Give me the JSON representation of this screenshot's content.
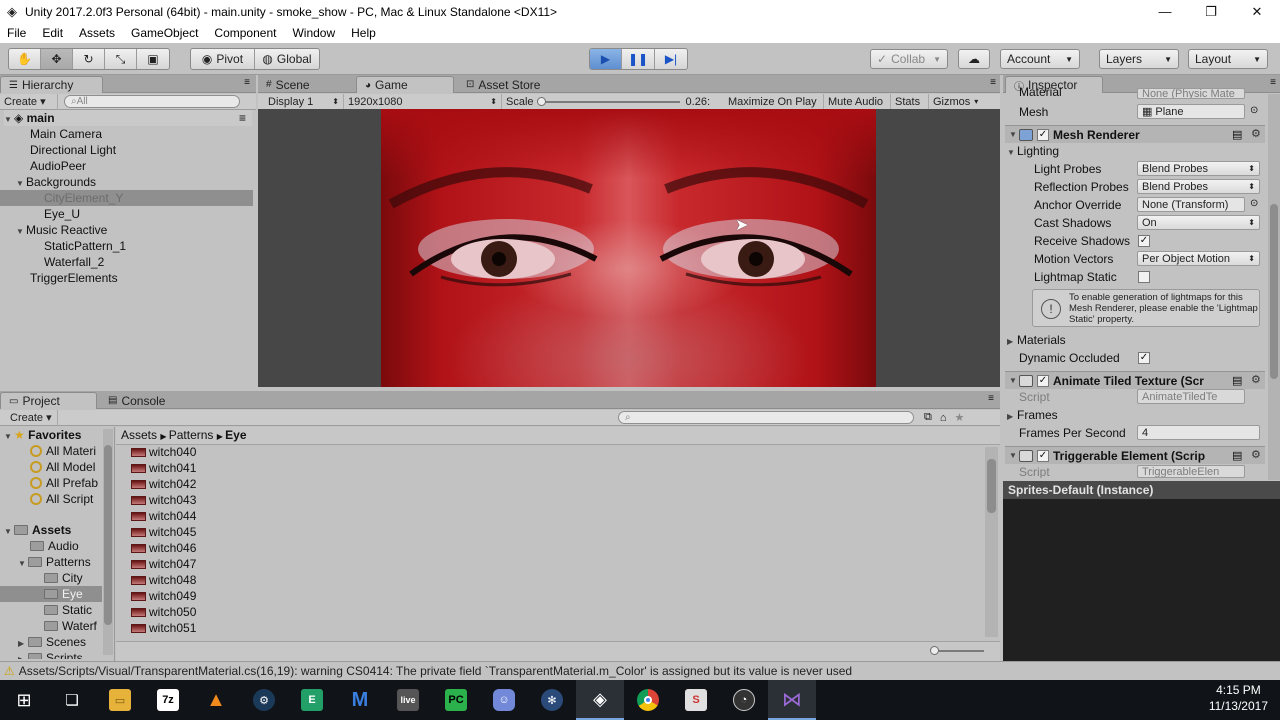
{
  "window": {
    "title": "Unity 2017.2.0f3 Personal (64bit) - main.unity - smoke_show - PC, Mac & Linux Standalone <DX11>",
    "app_icon": "unity-icon",
    "controls": [
      "—",
      "❐",
      "✕"
    ]
  },
  "menu": [
    "File",
    "Edit",
    "Assets",
    "GameObject",
    "Component",
    "Window",
    "Help"
  ],
  "toolbar": {
    "tools": [
      "hand-tool",
      "move-tool",
      "rotate-tool",
      "scale-tool",
      "rect-tool"
    ],
    "pivot_label": "Pivot",
    "global_label": "Global",
    "collab_label": "Collab",
    "account_label": "Account",
    "layers_label": "Layers",
    "layout_label": "Layout"
  },
  "hierarchy": {
    "tab": "Hierarchy",
    "create_label": "Create",
    "search_placeholder": "All",
    "scene": "main",
    "items": [
      {
        "label": "Main Camera"
      },
      {
        "label": "Directional Light"
      },
      {
        "label": "AudioPeer"
      },
      {
        "label": "Backgrounds"
      },
      {
        "label": "CityElement_Y"
      },
      {
        "label": "Eye_U"
      },
      {
        "label": "Music Reactive"
      },
      {
        "label": "StaticPattern_1"
      },
      {
        "label": "Waterfall_2"
      },
      {
        "label": "TriggerElements"
      }
    ]
  },
  "center_tabs": {
    "scene": "Scene",
    "game": "Game",
    "store": "Asset Store"
  },
  "game_bar": {
    "display": "Display 1",
    "resolution": "1920x1080",
    "scale_label": "Scale",
    "scale_value": "0.26:",
    "maximize": "Maximize On Play",
    "mute": "Mute Audio",
    "stats": "Stats",
    "gizmos": "Gizmos"
  },
  "inspector": {
    "tab": "Inspector",
    "material_label": "Material",
    "material_value": "None (Physic Mate",
    "mesh_label": "Mesh",
    "mesh_value": "Plane",
    "mesh_renderer": "Mesh Renderer",
    "lighting": "Lighting",
    "light_probes_label": "Light Probes",
    "light_probes_value": "Blend Probes",
    "reflection_probes_label": "Reflection Probes",
    "reflection_probes_value": "Blend Probes",
    "anchor_label": "Anchor Override",
    "anchor_value": "None (Transform)",
    "cast_label": "Cast Shadows",
    "cast_value": "On",
    "receive_label": "Receive Shadows",
    "motion_label": "Motion Vectors",
    "motion_value": "Per Object Motion",
    "lightmap_label": "Lightmap Static",
    "info": "To enable generation of lightmaps for this Mesh Renderer, please enable the 'Lightmap Static' property.",
    "materials": "Materials",
    "dynamic_label": "Dynamic Occluded",
    "animate": "Animate Tiled Texture (Scr",
    "script_label": "Script",
    "animate_script": "AnimateTiledTe",
    "frames": "Frames",
    "fps_label": "Frames Per Second",
    "fps_value": "4",
    "triggerable": "Triggerable Element (Scrip",
    "trig_script": "TriggerableElen",
    "preview_title": "Sprites-Default (Instance)"
  },
  "project": {
    "tab": "Project",
    "console_tab": "Console",
    "create_label": "Create",
    "favorites": "Favorites",
    "fav_items": [
      "All Materi",
      "All Model",
      "All Prefab",
      "All Script"
    ],
    "assets": "Assets",
    "folders": [
      {
        "label": "Audio"
      },
      {
        "label": "Patterns"
      },
      {
        "label": "City"
      },
      {
        "label": "Eye"
      },
      {
        "label": "Static"
      },
      {
        "label": "Waterf"
      },
      {
        "label": "Scenes"
      },
      {
        "label": "Scripts"
      }
    ],
    "breadcrumb": [
      "Assets",
      "Patterns",
      "Eye"
    ],
    "files": [
      "witch040",
      "witch041",
      "witch042",
      "witch043",
      "witch044",
      "witch045",
      "witch046",
      "witch047",
      "witch048",
      "witch049",
      "witch050",
      "witch051"
    ]
  },
  "status": {
    "message": "Assets/Scripts/Visual/TransparentMaterial.cs(16,19): warning CS0414: The private field `TransparentMaterial.m_Color' is assigned but its value is never used"
  },
  "taskbar": {
    "time": "4:15 PM",
    "date": "11/13/2017",
    "apps": [
      "windows-start-icon",
      "task-view-icon",
      "file-explorer-icon",
      "7zip-icon",
      "vlc-icon",
      "steam-icon",
      "editor-icon",
      "malwarebytes-icon",
      "livestream-icon",
      "pycharm-icon",
      "discord-icon",
      "network-icon",
      "unity-icon",
      "chrome-icon",
      "sublime-icon",
      "obs-icon",
      "visual-studio-icon"
    ]
  }
}
